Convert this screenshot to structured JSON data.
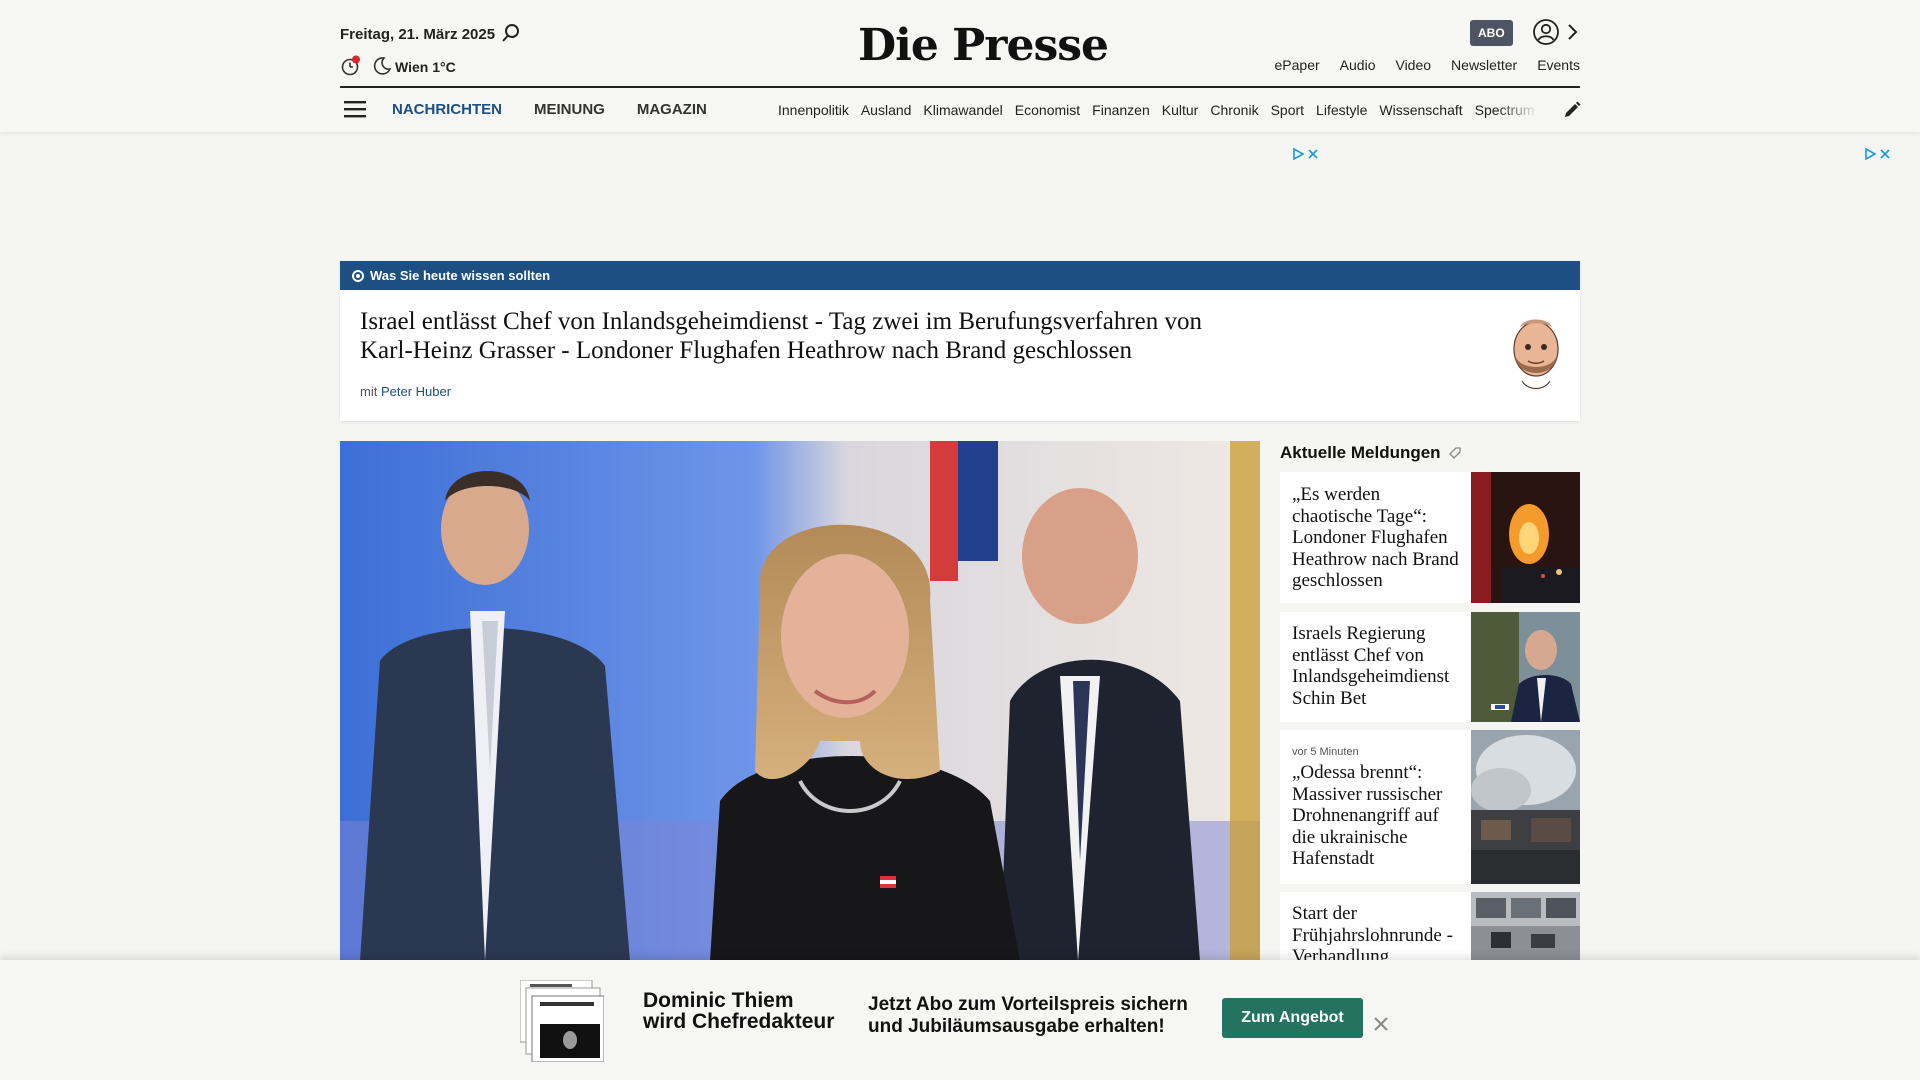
{
  "header": {
    "date": "Freitag, 21. März 2025",
    "weather": "Wien 1°C",
    "logo": "Die Presse",
    "abo_label": "ABO",
    "top_links": [
      "ePaper",
      "Audio",
      "Video",
      "Newsletter",
      "Events"
    ],
    "main_nav": [
      "NACHRICHTEN",
      "MEINUNG",
      "MAGAZIN"
    ],
    "sub_nav": [
      "Innenpolitik",
      "Ausland",
      "Klimawandel",
      "Economist",
      "Finanzen",
      "Kultur",
      "Chronik",
      "Sport",
      "Lifestyle",
      "Wissenschaft",
      "Spectrum"
    ],
    "accent_color": "#1d4f82"
  },
  "briefing": {
    "label": "Was Sie heute wissen sollten",
    "headline": "Israel entlässt Chef von Inlandsgeheimdienst - Tag zwei im Berufungsverfahren von Karl-Heinz Grasser - Londoner Flughafen Heathrow nach Brand geschlossen",
    "author_prefix": "mit",
    "author_name": "Peter Huber"
  },
  "sidebar": {
    "title": "Aktuelle Meldungen",
    "items": [
      {
        "headline": "„Es werden chaotische Tage“: Londoner Flughafen Heathrow nach Brand geschlossen",
        "meta": ""
      },
      {
        "headline": "Israels Regierung entlässt Chef von Inlandsgeheimdienst Schin Bet",
        "meta": ""
      },
      {
        "headline": "„Odessa brennt“: Massiver russischer Drohnenangriff auf die ukrainische Hafenstadt",
        "meta": "vor 5 Minuten"
      },
      {
        "headline": "Start der Frühjahrslohnrunde - Verhandlung",
        "meta": ""
      }
    ]
  },
  "promo": {
    "title_line1": "Dominic Thiem",
    "title_line2": "wird Chefredakteur",
    "text_line1": "Jetzt Abo zum Vorteilspreis sichern",
    "text_line2": "und Jubiläumsausgabe erhalten!",
    "button": "Zum Angebot",
    "button_color": "#237360"
  }
}
